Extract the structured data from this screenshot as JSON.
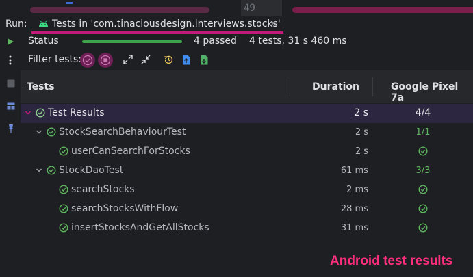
{
  "editor": {
    "line_number": "49"
  },
  "run_bar": {
    "run_label": "Run:",
    "tab_label": "Tests in 'com.tinaciousdesign.interviews.stocks'",
    "close_glyph": "×"
  },
  "status": {
    "label": "Status",
    "progress_fraction": 1.0,
    "passed_text": "4 passed",
    "summary_text": "4 tests, 31 s 460 ms"
  },
  "filter": {
    "label": "Filter tests:",
    "icons": [
      "show-passed-icon",
      "show-ignored-icon",
      "expand-all-icon",
      "collapse-all-icon",
      "history-icon",
      "export-icon",
      "import-icon"
    ]
  },
  "table": {
    "headers": {
      "tests": "Tests",
      "duration": "Duration",
      "device": "Google Pixel 7a"
    },
    "rows": [
      {
        "name": "Test Results",
        "duration": "2 s",
        "device": "4/4",
        "level": 0,
        "expandable": true
      },
      {
        "name": "StockSearchBehaviourTest",
        "duration": "2 s",
        "device": "1/1",
        "level": 1,
        "expandable": true
      },
      {
        "name": "userCanSearchForStocks",
        "duration": "2 s",
        "device": "",
        "level": 2,
        "expandable": false
      },
      {
        "name": "StockDaoTest",
        "duration": "61 ms",
        "device": "3/3",
        "level": 1,
        "expandable": true
      },
      {
        "name": "searchStocks",
        "duration": "2 ms",
        "device": "",
        "level": 2,
        "expandable": false
      },
      {
        "name": "searchStocksWithFlow",
        "duration": "28 ms",
        "device": "",
        "level": 2,
        "expandable": false
      },
      {
        "name": "insertStocksAndGetAllStocks",
        "duration": "31 ms",
        "device": "",
        "level": 2,
        "expandable": false
      }
    ]
  },
  "watermark": "Android test results",
  "colors": {
    "accent": "#c2197c",
    "pass_green": "#5fb55f",
    "watermark": "#ff2e7e",
    "background": "#1e1f22"
  }
}
